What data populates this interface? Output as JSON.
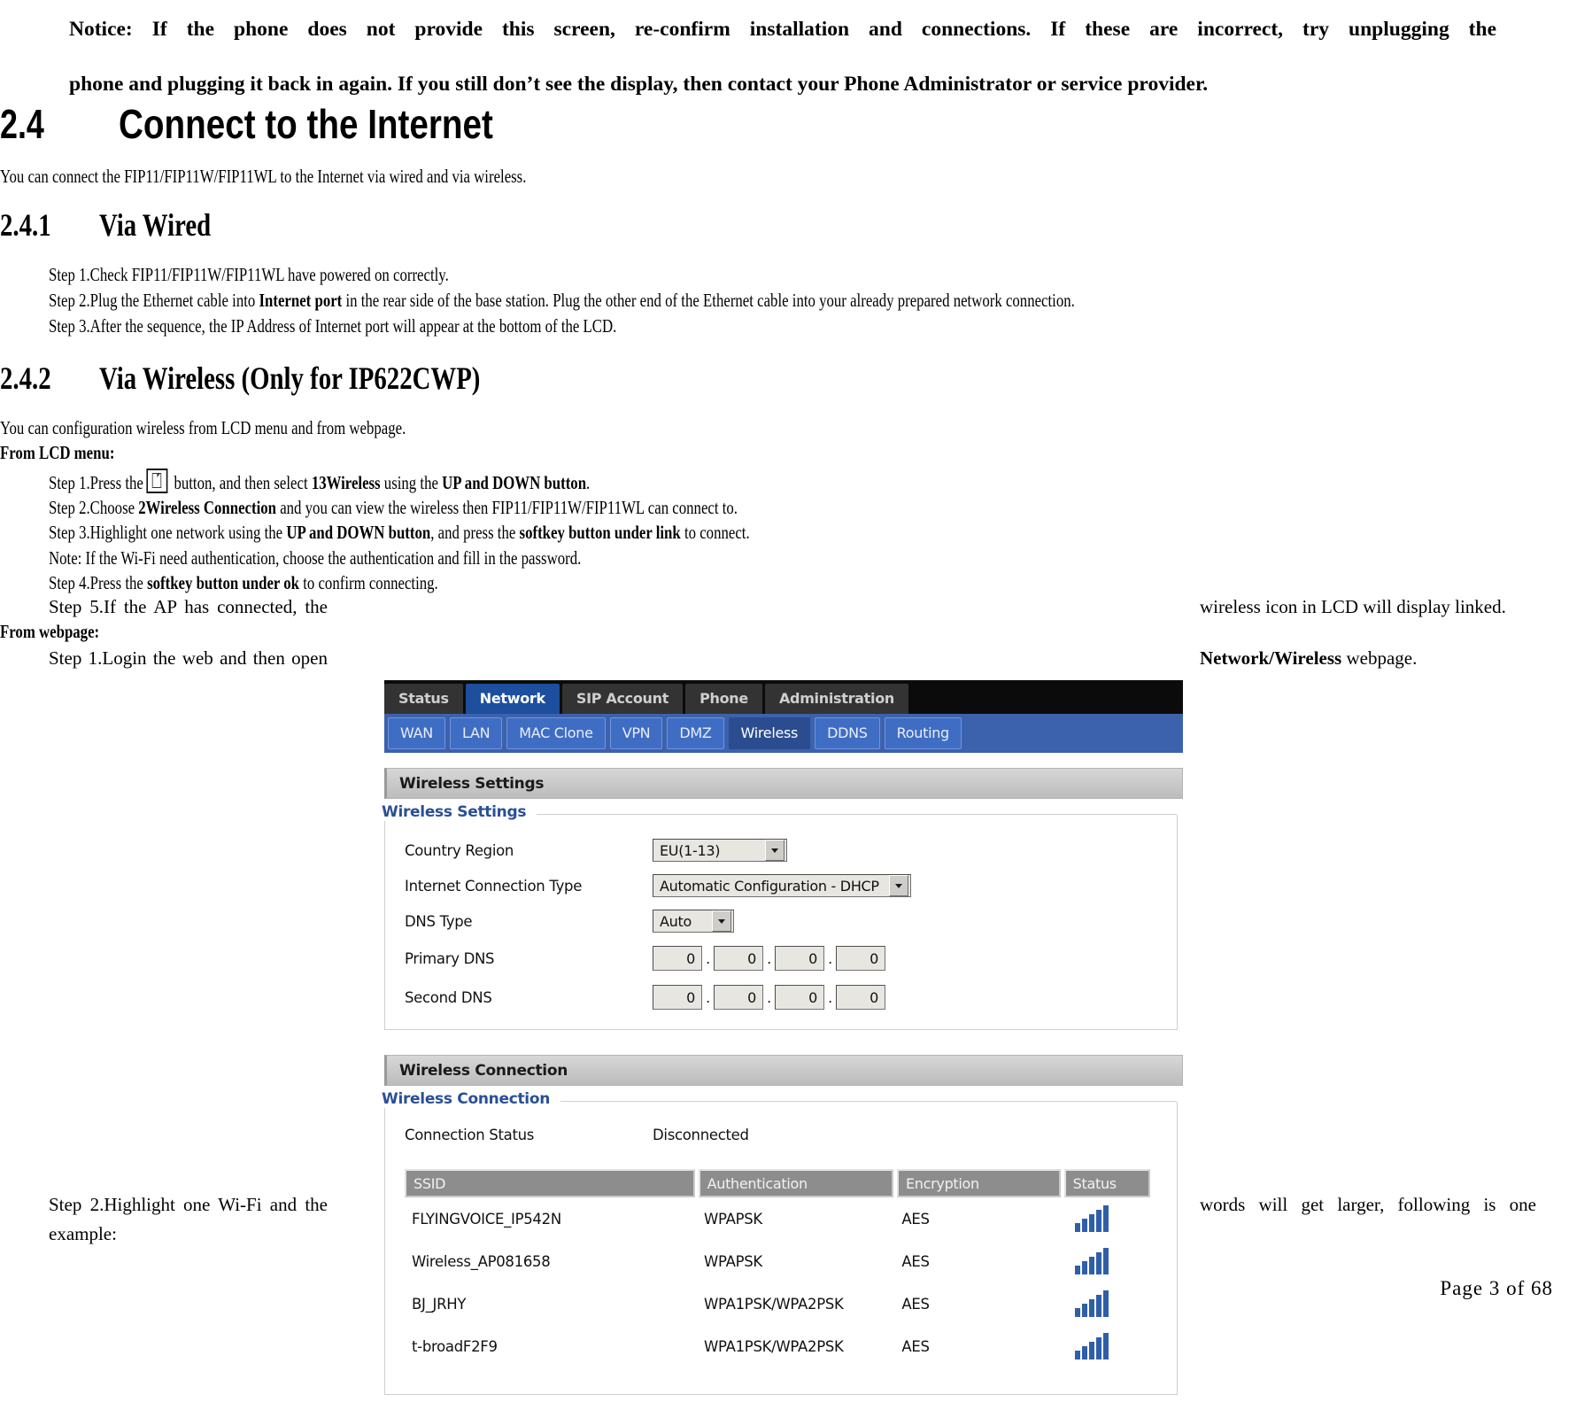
{
  "notice": {
    "line1": "Notice: If the phone does not provide this screen, re-confirm installation and connections. If these are incorrect, try unplugging the",
    "line2": "phone and plugging it back in again. If you still don’t see the display, then contact your Phone Administrator or service provider."
  },
  "headings": {
    "h24_num": "2.4",
    "h24_title": "Connect to the Internet",
    "h241_num": "2.4.1",
    "h241_title": "Via Wired",
    "h242_num": "2.4.2",
    "h242_title": "Via Wireless (Only for IP622CWP)"
  },
  "intro": {
    "wired": "You can connect the FIP11/FIP11W/FIP11WL to the Internet via wired and via wireless.",
    "wireless": "You can configuration wireless from LCD menu and from webpage."
  },
  "wired_steps": {
    "step1": "Step 1.Check FIP11/FIP11W/FIP11WL have powered on correctly.",
    "step2_a": "Step 2.Plug the Ethernet cable into ",
    "step2_b": "Internet port",
    "step2_c": " in the rear side of the base station. Plug the other end of the Ethernet cable into your already prepared network connection.",
    "step3": "Step 3.After the sequence, the IP Address of Internet port will appear at the bottom of the LCD."
  },
  "lcd": {
    "label": "From LCD menu:",
    "step1_a": "Step 1.Press the",
    "step1_icon": "document-icon",
    "step1_b": " button, and then select ",
    "step1_c": "13Wireless",
    "step1_d": " using the ",
    "step1_e": "UP and DOWN button",
    "step1_f": ".",
    "step2_a": "Step 2.Choose ",
    "step2_b": "2Wireless Connection",
    "step2_c": " and you can view the wireless then FIP11/FIP11W/FIP11WL can connect to.",
    "step3_a": "Step 3.Highlight one network using the ",
    "step3_b": "UP and DOWN button",
    "step3_c": ", and press the ",
    "step3_d": "softkey button under link",
    "step3_e": " to connect.",
    "note": "Note: If the Wi-Fi need authentication, choose the authentication and fill in the password.",
    "step4_a": "Step 4.Press the ",
    "step4_b": "softkey button under ok",
    "step4_c": " to confirm connecting.",
    "step5_left": "Step 5.If the AP has connected, the",
    "step5_right": "wireless icon in LCD will display linked."
  },
  "webpage": {
    "label": "From webpage:",
    "step1_left": "Step 1.Login the web and then open",
    "step1_right_bold": "Network/Wireless",
    "step1_right_rest": " webpage.",
    "step2_left_line1": "Step 2.Highlight one Wi-Fi and the",
    "step2_left_line2": "example:",
    "step2_right": "words will get larger, following is one"
  },
  "webui": {
    "top_tabs": [
      {
        "label": "Status",
        "active": false
      },
      {
        "label": "Network",
        "active": true
      },
      {
        "label": "SIP Account",
        "active": false
      },
      {
        "label": "Phone",
        "active": false
      },
      {
        "label": "Administration",
        "active": false
      }
    ],
    "sub_tabs": [
      {
        "label": "WAN",
        "active": false
      },
      {
        "label": "LAN",
        "active": false
      },
      {
        "label": "MAC Clone",
        "active": false
      },
      {
        "label": "VPN",
        "active": false
      },
      {
        "label": "DMZ",
        "active": false
      },
      {
        "label": "Wireless",
        "active": true
      },
      {
        "label": "DDNS",
        "active": false
      },
      {
        "label": "Routing",
        "active": false
      }
    ],
    "wireless_settings": {
      "bar_title": "Wireless Settings",
      "legend": "Wireless Settings",
      "country_region_label": "Country Region",
      "country_region_value": "EU(1-13)",
      "conn_type_label": "Internet Connection Type",
      "conn_type_value": "Automatic Configuration - DHCP",
      "dns_type_label": "DNS Type",
      "dns_type_value": "Auto",
      "primary_dns_label": "Primary DNS",
      "primary_dns_octets": [
        "0",
        "0",
        "0",
        "0"
      ],
      "second_dns_label": "Second DNS",
      "second_dns_octets": [
        "0",
        "0",
        "0",
        "0"
      ]
    },
    "wireless_connection": {
      "bar_title": "Wireless Connection",
      "legend": "Wireless Connection",
      "status_label": "Connection Status",
      "status_value": "Disconnected",
      "columns": [
        "SSID",
        "Authentication",
        "Encryption",
        "Status"
      ],
      "rows": [
        {
          "ssid": "FLYINGVOICE_IP542N",
          "auth": "WPAPSK",
          "enc": "AES",
          "signal": "signal-bars-icon"
        },
        {
          "ssid": "Wireless_AP081658",
          "auth": "WPAPSK",
          "enc": "AES",
          "signal": "signal-bars-icon"
        },
        {
          "ssid": "BJ_JRHY",
          "auth": "WPA1PSK/WPA2PSK",
          "enc": "AES",
          "signal": "signal-bars-icon"
        },
        {
          "ssid": "t-broadF2F9",
          "auth": "WPA1PSK/WPA2PSK",
          "enc": "AES",
          "signal": "signal-bars-icon"
        }
      ]
    },
    "colors": {
      "nav_top_bg": "#0b0b0b",
      "nav_top_tab": "#333333",
      "nav_active": "#1d4f9e",
      "nav_sub_bg": "#3d62ad",
      "sub_tab": "#3f6dc4",
      "table_header": "#8d8d8d",
      "legend_text": "#2a4f96",
      "signal_bar": "#2e5fa8"
    }
  },
  "footer": {
    "text": "Page  3  of  68"
  }
}
